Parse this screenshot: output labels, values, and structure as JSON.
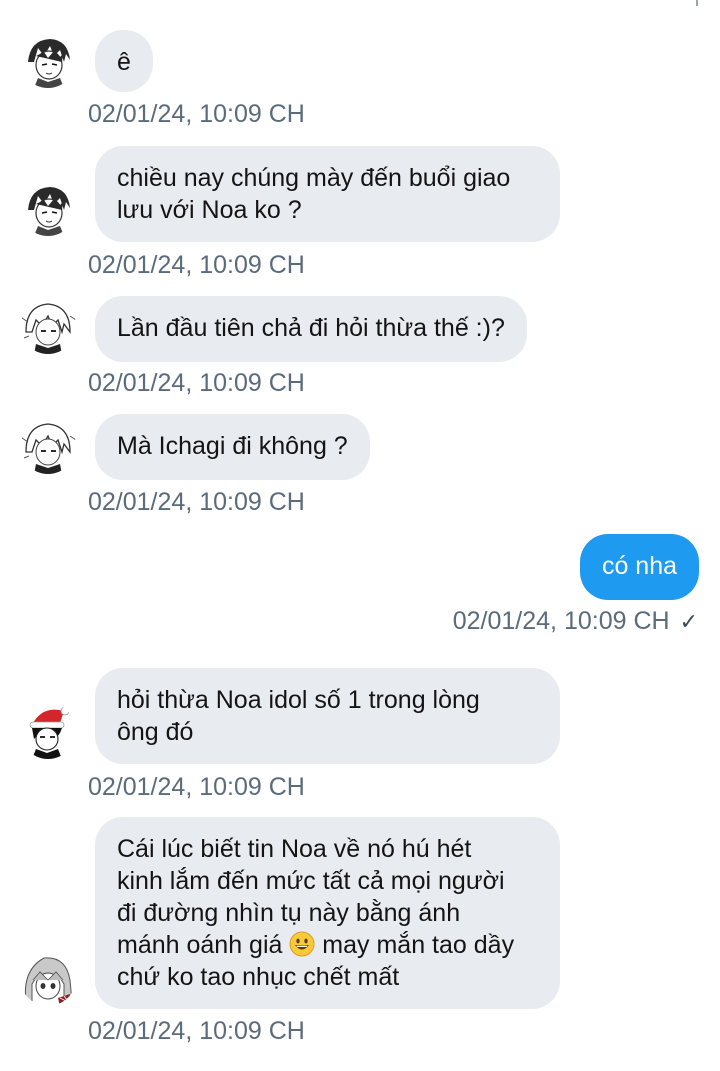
{
  "messages": [
    {
      "sender": "avatar-a",
      "direction": "incoming",
      "lines": [
        "ê"
      ],
      "time": "02/01/24, 10:09 CH"
    },
    {
      "sender": "avatar-a",
      "direction": "incoming",
      "lines": [
        "chiều nay chúng mày đến buổi giao",
        "lưu với Noa ko ?"
      ],
      "time": "02/01/24, 10:09 CH"
    },
    {
      "sender": "avatar-b",
      "direction": "incoming",
      "lines": [
        "Lần đầu tiên chả đi hỏi thừa thế :)?"
      ],
      "time": "02/01/24, 10:09 CH"
    },
    {
      "sender": "avatar-b",
      "direction": "incoming",
      "lines": [
        "Mà Ichagi đi không ?"
      ],
      "time": "02/01/24, 10:09 CH"
    },
    {
      "sender": "me",
      "direction": "outgoing",
      "lines": [
        "có nha"
      ],
      "time": "02/01/24, 10:09 CH",
      "status_icon": "✓"
    },
    {
      "sender": "avatar-c",
      "direction": "incoming",
      "lines": [
        "hỏi thừa Noa idol số 1 trong lòng",
        "ông đó"
      ],
      "time": "02/01/24, 10:09 CH"
    },
    {
      "sender": "avatar-d",
      "direction": "incoming",
      "lines": [
        "Cái lúc biết tin Noa về nó hú hét",
        "kinh lắm đến mức tất cả mọi người",
        "đi đường nhìn tụ này bằng ánh",
        "mánh oánh giá",
        " may mắn tao dầy",
        "chứ ko tao nhục chết mất"
      ],
      "emoji": "grinning-face-emoji",
      "time": "02/01/24, 10:09 CH"
    }
  ],
  "colors": {
    "incoming_bubble": "#e8ebef",
    "outgoing_bubble": "#1e9bf0",
    "timestamp": "#5a6b7b"
  }
}
